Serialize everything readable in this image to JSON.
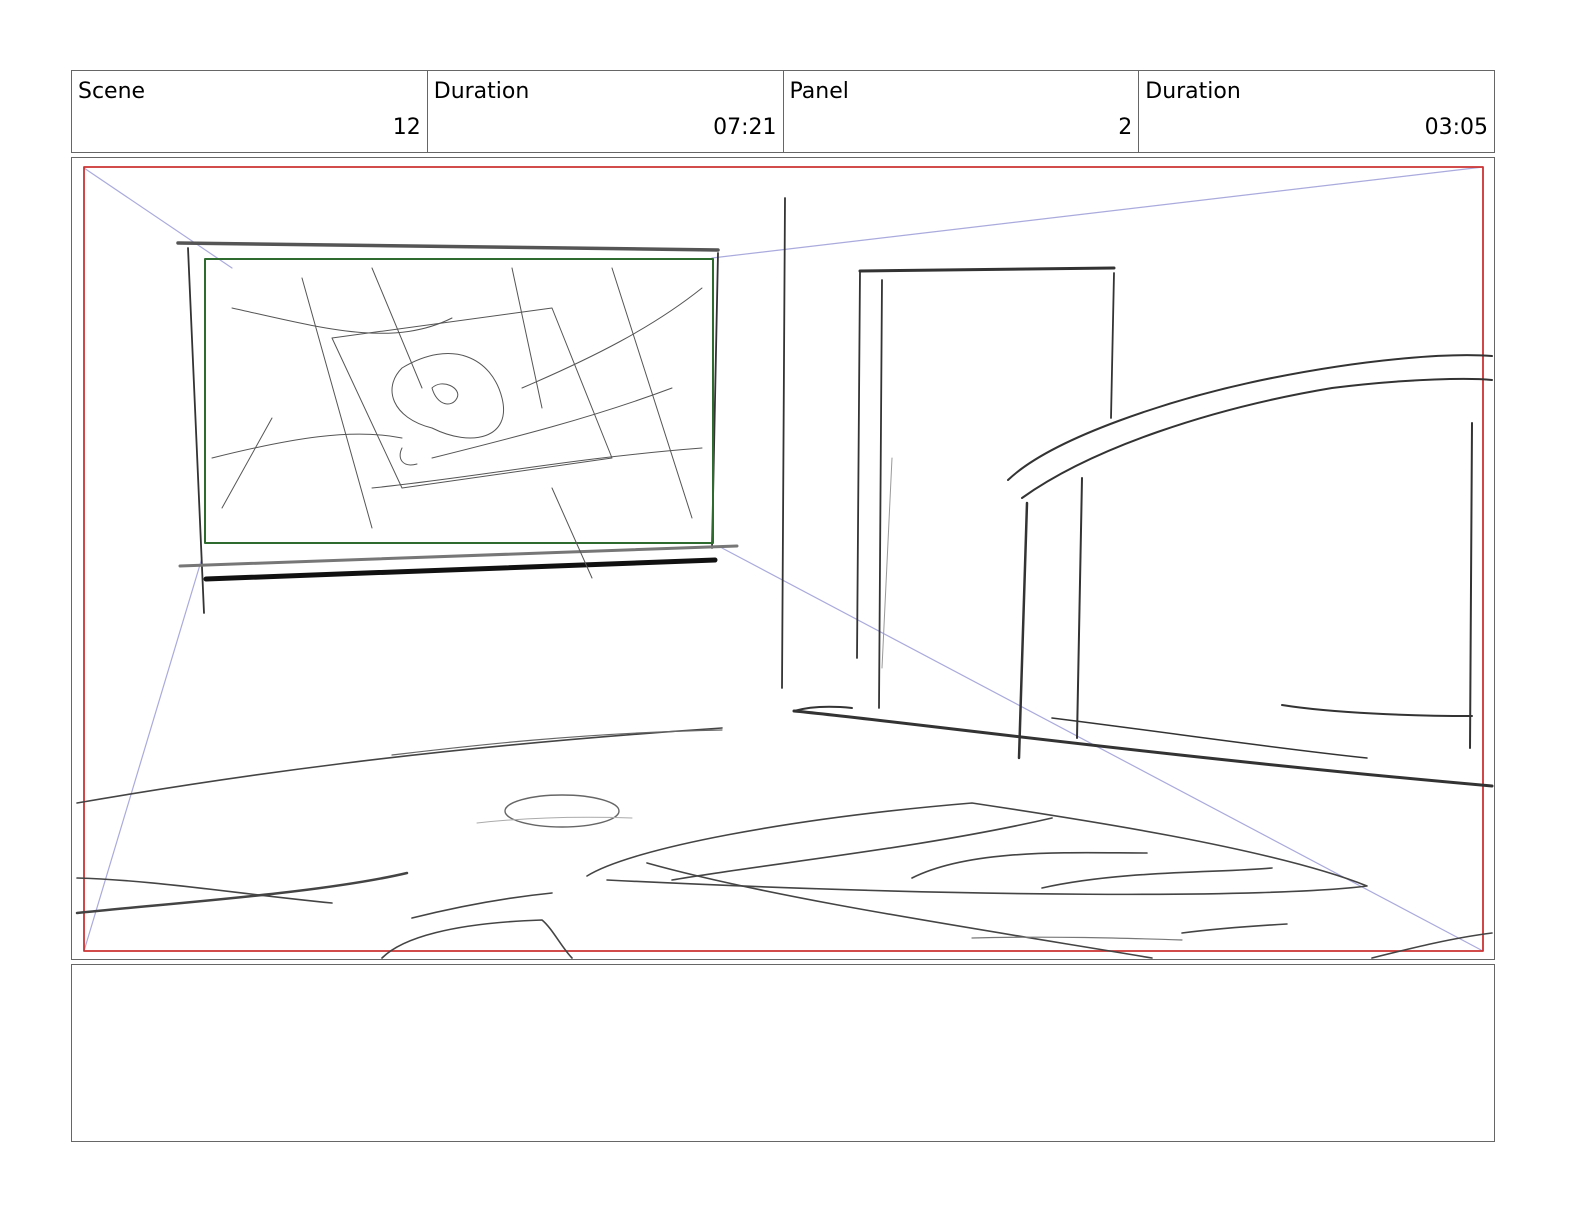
{
  "header": {
    "scene": {
      "label": "Scene",
      "value": "12"
    },
    "scene_duration": {
      "label": "Duration",
      "value": "07:21"
    },
    "panel": {
      "label": "Panel",
      "value": "2"
    },
    "panel_duration": {
      "label": "Duration",
      "value": "03:05"
    }
  },
  "notes": {
    "text": ""
  },
  "colors": {
    "frame_border": "#cc3333",
    "screen_border": "#2e6b2e",
    "guide_line": "#aaaadd",
    "sketch_line": "#333333"
  }
}
